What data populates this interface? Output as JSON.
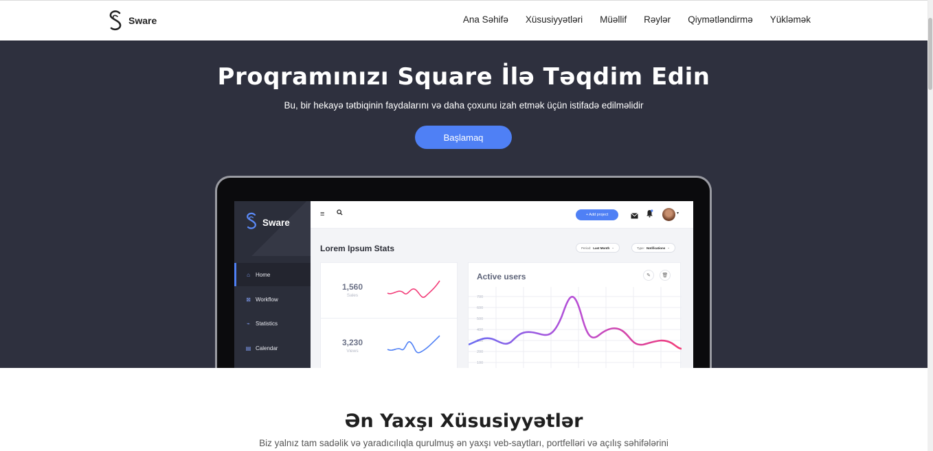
{
  "brand": {
    "name": "Sware"
  },
  "nav": [
    {
      "label": "Ana Səhifə"
    },
    {
      "label": "Xüsusiyyətləri"
    },
    {
      "label": "Müəllif"
    },
    {
      "label": "Rəylər"
    },
    {
      "label": "Qiymətləndirmə"
    },
    {
      "label": "Yükləmək"
    }
  ],
  "hero": {
    "title": "Proqramınızı Square İlə Təqdim Edin",
    "subtitle": "Bu, bir hekayə tətbiqinin faydalarını və daha çoxunu izah etmək üçün istifadə edilməlidir",
    "cta_label": "Başlamaq"
  },
  "app": {
    "brand": "Sware",
    "sidebar": [
      {
        "label": "Home",
        "icon": "home-icon",
        "active": true
      },
      {
        "label": "Workflow",
        "icon": "workflow-icon",
        "active": false
      },
      {
        "label": "Statistics",
        "icon": "statistics-icon",
        "active": false
      },
      {
        "label": "Calendar",
        "icon": "calendar-icon",
        "active": false
      }
    ],
    "add_project_label": "+ Add project",
    "stats_title": "Lorem Ipsum Stats",
    "filters": [
      {
        "prefix": "Period:",
        "value": "Last Month"
      },
      {
        "prefix": "Type:",
        "value": "Notifications"
      }
    ],
    "mini_stats": [
      {
        "value": "1,560",
        "label": "Sales",
        "color": "#f23c78"
      },
      {
        "value": "3,230",
        "label": "Views",
        "color": "#4f80f5"
      }
    ],
    "active_users": {
      "title": "Active users",
      "y_ticks": [
        "700",
        "600",
        "500",
        "400",
        "300",
        "200",
        "100"
      ]
    }
  },
  "features": {
    "title": "Ən Yaxşı Xüsusiyyətlər",
    "subtitle": "Biz yalnız tam sadəlik və yaradıcılıqla qurulmuş ən yaxşı veb-saytları, portfelləri və açılış səhifələrini"
  },
  "colors": {
    "accent": "#4f80f5",
    "hero_bg": "#2e303e",
    "pink": "#f23c78"
  }
}
